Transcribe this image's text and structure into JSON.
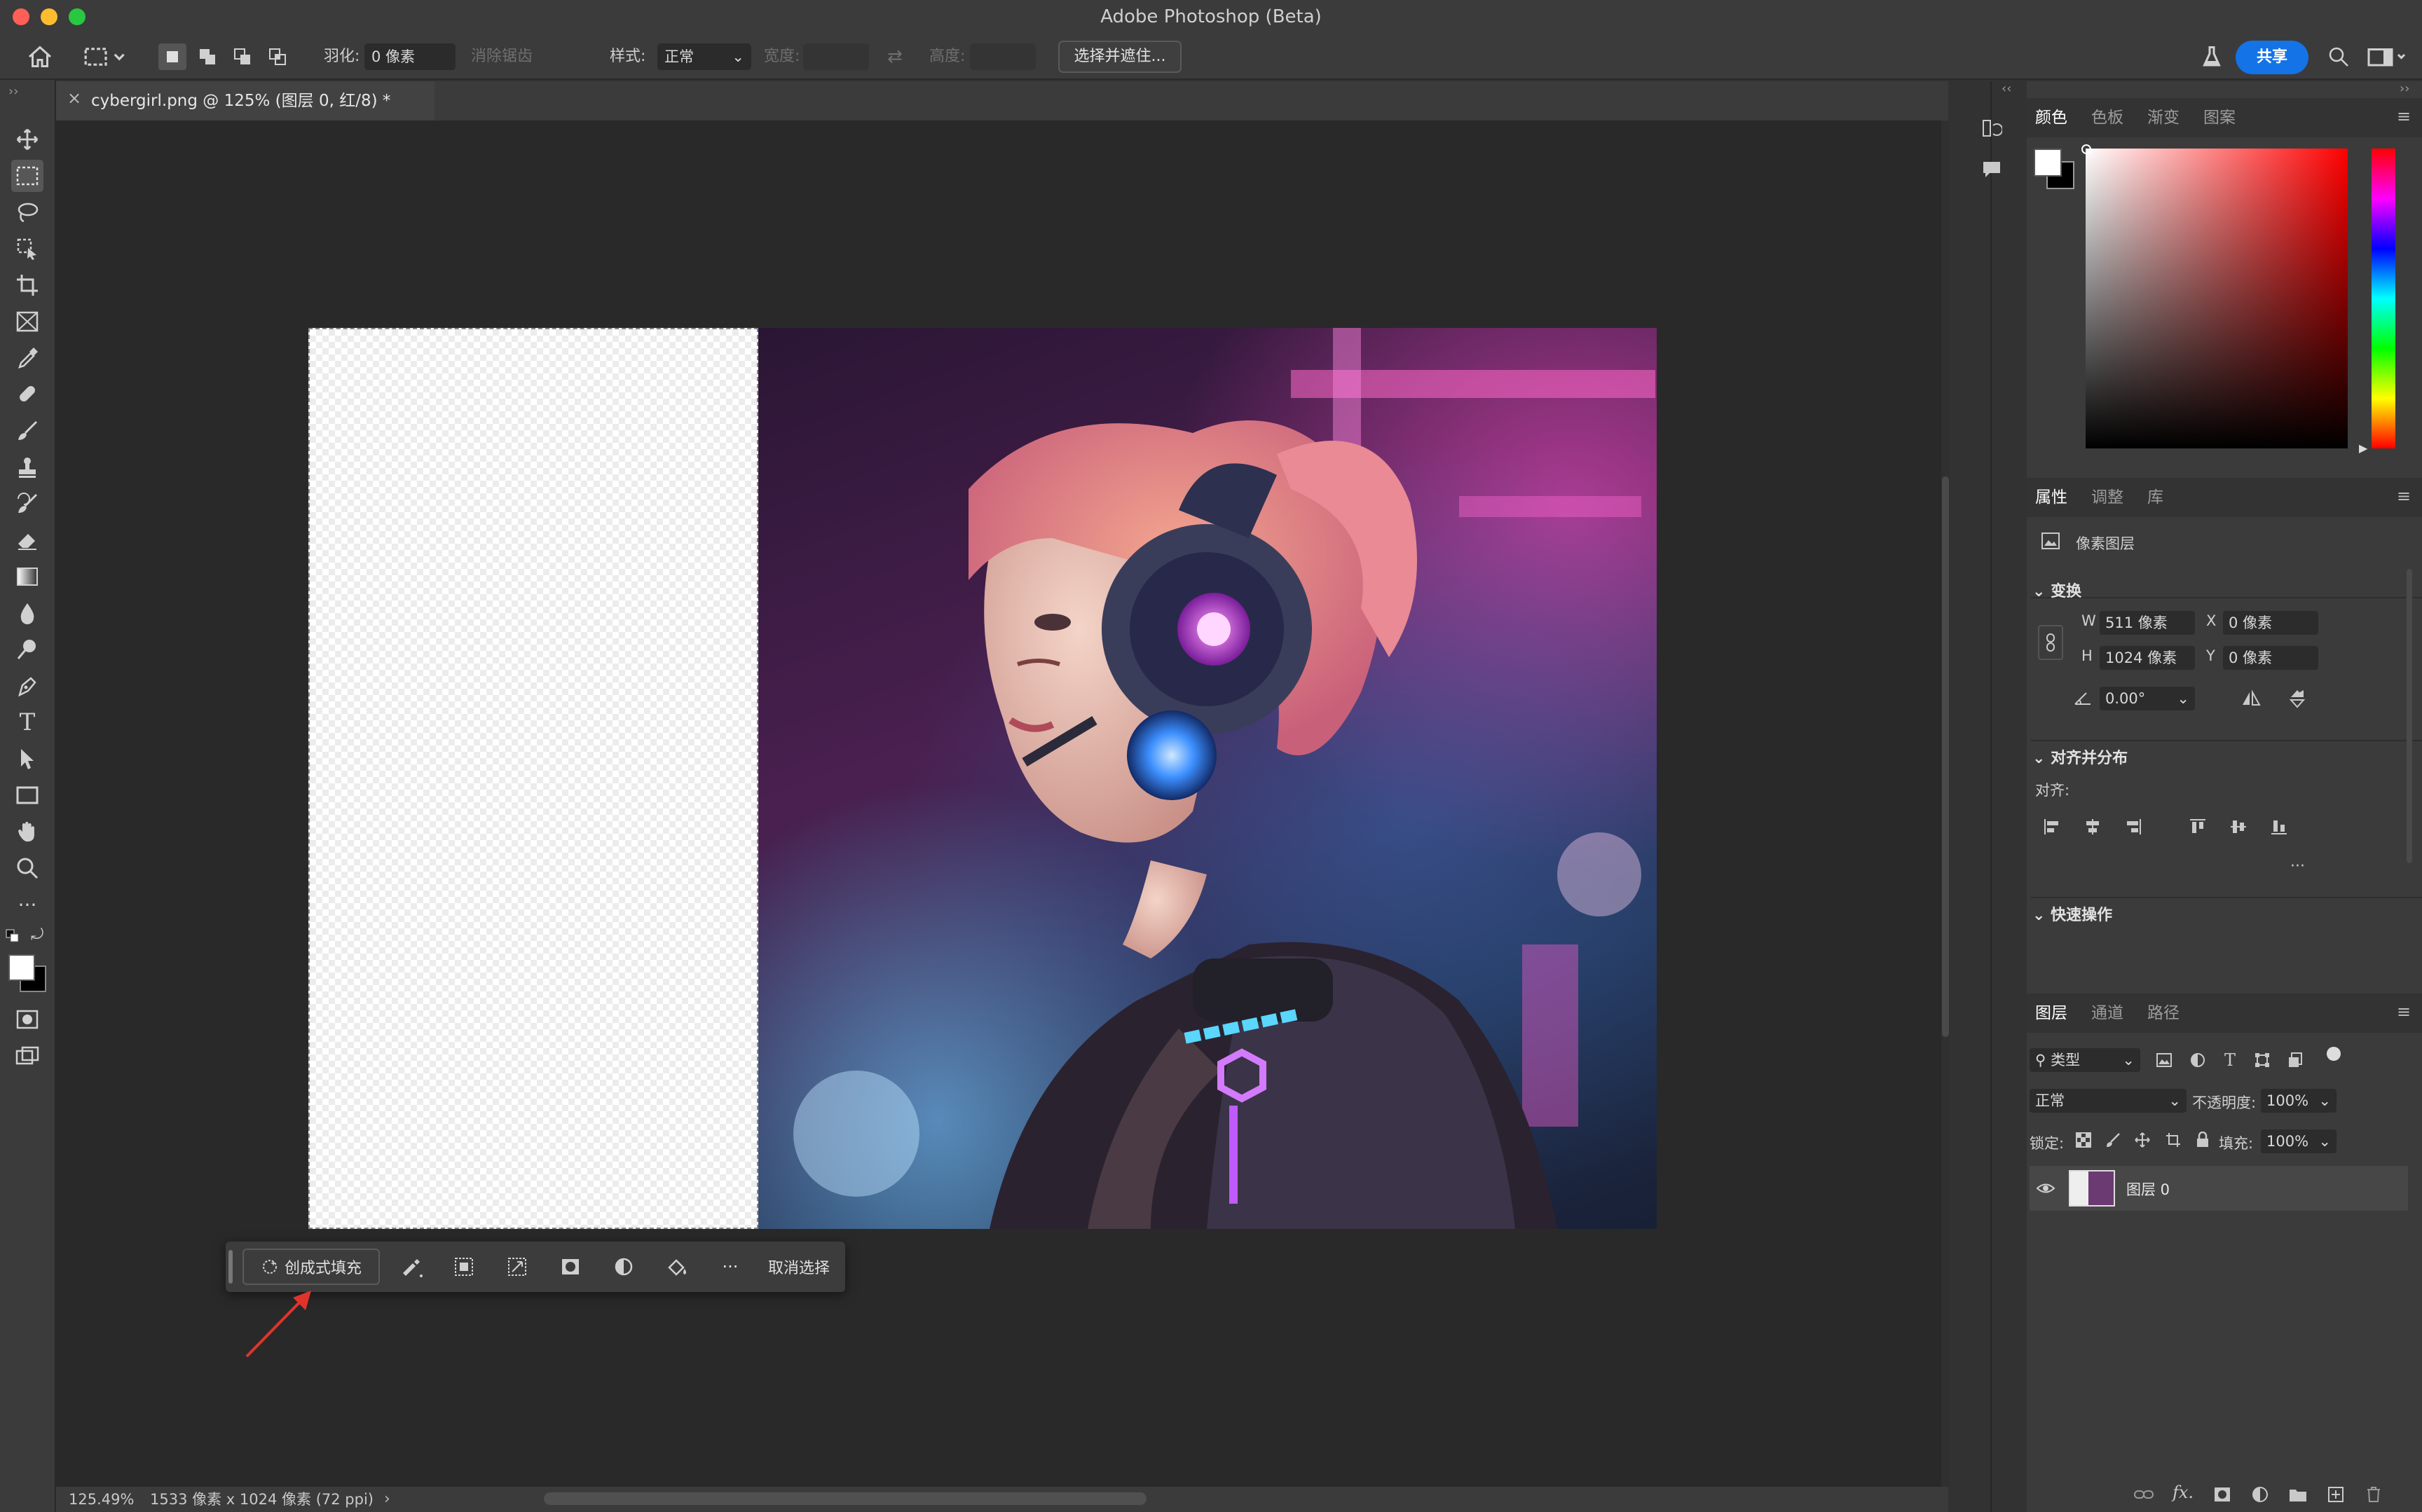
{
  "app": {
    "title": "Adobe Photoshop (Beta)"
  },
  "options": {
    "feather_label": "羽化:",
    "feather_value": "0 像素",
    "antialias_label": "消除锯齿",
    "style_label": "样式:",
    "style_value": "正常",
    "width_label": "宽度:",
    "height_label": "高度:",
    "select_mask_button": "选择并遮住...",
    "share_button": "共享"
  },
  "document": {
    "tab_title": "cybergirl.png @ 125% (图层 0, 红/8) *",
    "close_glyph": "×"
  },
  "status": {
    "zoom": "125.49%",
    "doc_size": "1533 像素 x 1024 像素 (72 ppi)",
    "more_glyph": "›"
  },
  "context_bar": {
    "generative_fill": "创成式填充",
    "deselect": "取消选择",
    "more_glyph": "···"
  },
  "color_panel": {
    "tabs": [
      "颜色",
      "色板",
      "渐变",
      "图案"
    ],
    "active": "颜色"
  },
  "properties_panel": {
    "tabs": [
      "属性",
      "调整",
      "库"
    ],
    "layer_kind": "像素图层",
    "transform_section": "变换",
    "w_label": "W",
    "w_value": "511 像素",
    "h_label": "H",
    "h_value": "1024 像素",
    "x_label": "X",
    "x_value": "0 像素",
    "y_label": "Y",
    "y_value": "0 像素",
    "angle_value": "0.00°",
    "align_section": "对齐并分布",
    "align_label": "对齐:",
    "quick_actions_section": "快速操作",
    "more_glyph": "···"
  },
  "layers_panel": {
    "tabs": [
      "图层",
      "通道",
      "路径"
    ],
    "filter_label": "类型",
    "blend_mode": "正常",
    "opacity_label": "不透明度:",
    "opacity_value": "100%",
    "lock_label": "锁定:",
    "fill_label": "填充:",
    "fill_value": "100%",
    "layers": [
      {
        "name": "图层 0",
        "visible": true
      }
    ],
    "fx_label": "fx."
  },
  "colors": {
    "accent": "#1473e6",
    "panel_bg": "#3b3b3b",
    "canvas_bg": "#292929",
    "arrow": "#e0342b"
  }
}
